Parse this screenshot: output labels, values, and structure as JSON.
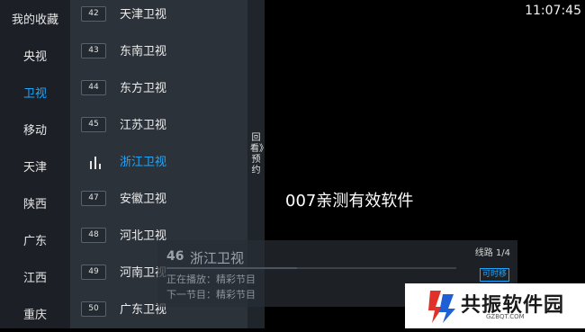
{
  "clock": "11:07:45",
  "overlay_text": "007亲测有效软件",
  "categories": [
    {
      "label": "我的收藏",
      "active": false
    },
    {
      "label": "央视",
      "active": false
    },
    {
      "label": "卫视",
      "active": true
    },
    {
      "label": "移动",
      "active": false
    },
    {
      "label": "天津",
      "active": false
    },
    {
      "label": "陕西",
      "active": false
    },
    {
      "label": "广东",
      "active": false
    },
    {
      "label": "江西",
      "active": false
    },
    {
      "label": "重庆",
      "active": false
    }
  ],
  "channels": [
    {
      "number": "42",
      "name": "天津卫视",
      "playing": false
    },
    {
      "number": "43",
      "name": "东南卫视",
      "playing": false
    },
    {
      "number": "44",
      "name": "东方卫视",
      "playing": false
    },
    {
      "number": "45",
      "name": "江苏卫视",
      "playing": false
    },
    {
      "number": "46",
      "name": "浙江卫视",
      "playing": true
    },
    {
      "number": "47",
      "name": "安徽卫视",
      "playing": false
    },
    {
      "number": "48",
      "name": "河北卫视",
      "playing": false
    },
    {
      "number": "49",
      "name": "河南卫视",
      "playing": false
    },
    {
      "number": "50",
      "name": "广东卫视",
      "playing": false
    }
  ],
  "side_tab": {
    "label": "回看》预约"
  },
  "info_bar": {
    "channel_number": "46",
    "channel_name": "浙江卫视",
    "line": "线路 1/4",
    "now_playing": "正在播放：精彩节目",
    "next_program": "下一节目：精彩节目",
    "timeshift": "可时移",
    "progress": 0.45
  },
  "watermark": {
    "title": "共振软件园",
    "subtitle": "GZBQT.COM"
  },
  "colors": {
    "accent": "#1ea7ff",
    "category_bg": "#1c2026",
    "channel_bg": "#2b323a",
    "logo_red": "#e0322b",
    "logo_blue": "#1f5fd6"
  }
}
